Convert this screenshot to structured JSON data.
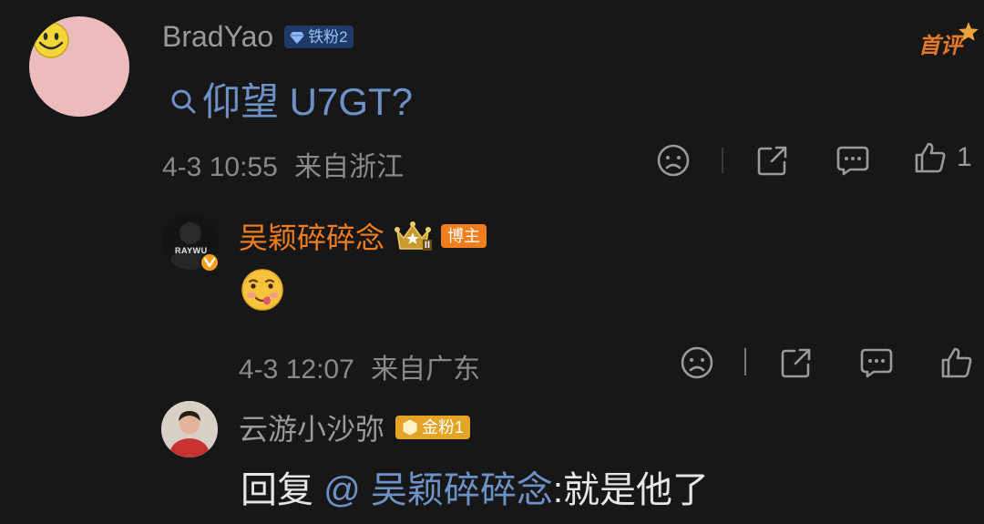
{
  "comment": {
    "username": "BradYao",
    "fan_badge": "铁粉2",
    "content": "仰望 U7GT?",
    "time": "4-3 10:55",
    "location": "来自浙江",
    "like_count": "1",
    "first_comment_tag": "首评",
    "avatar_icon": "smiley-face-icon"
  },
  "reply1": {
    "username": "吴颖碎碎念",
    "role_badge": "博主",
    "level_badge_icon": "crown-icon",
    "level_badge_text": "II",
    "avatar_text": "RAYWU",
    "content_icon": "drooling-face-emoji",
    "time": "4-3 12:07",
    "location": "来自广东"
  },
  "reply2": {
    "username": "云游小沙弥",
    "fan_badge": "金粉1",
    "mention": "@ 吴颖碎碎念",
    "reply_prefix": "回复 ",
    "content": ":就是他了"
  },
  "colors": {
    "background": "#171717",
    "username_gray": "#9a9a9a",
    "blogger_orange": "#f07d1e",
    "mention_blue": "#6e91c8",
    "iron_fan_blue": "#5b8ee0",
    "gold_fan": "#e3a427"
  }
}
